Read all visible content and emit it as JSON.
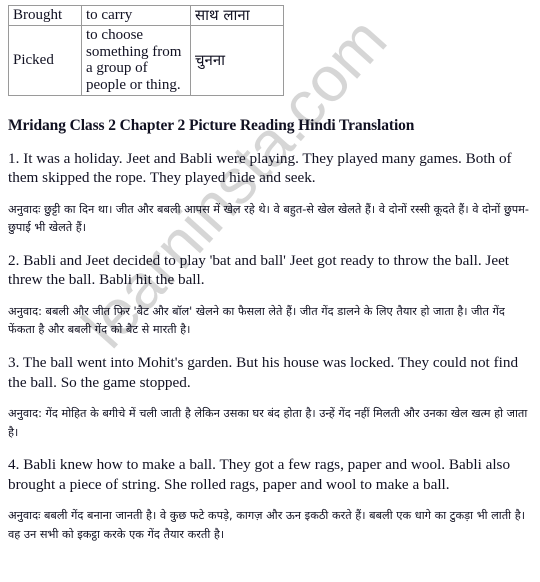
{
  "document": {
    "watermark_text": "learninsta.com",
    "watermark_color": "#cfcfcf",
    "text_color": "#111122",
    "table_border_color": "#9a9a9a"
  },
  "vocab_table": {
    "rows": [
      {
        "word": "Brought",
        "meaning": "to carry",
        "hindi": "साथ लाना"
      },
      {
        "word": "Picked",
        "meaning": "to choose something from a group of people or thing.",
        "hindi": "चुनना"
      }
    ]
  },
  "article": {
    "title": "Mridang Class 2 Chapter 2 Picture Reading Hindi Translation",
    "blocks": [
      {
        "english": "1. It was a holiday. Jeet and Babli were playing. They played many games. Both of them skipped the rope. They played hide and seek.",
        "hindi": "अनुवादः छुट्टी का दिन था। जीत और बबली आपस में खेल रहे थे। वे बहुत-से खेल खेलते हैं। वे दोनों रस्सी कूदते हैं। वे दोनों छुपम-छुपाई भी खेलते हैं।"
      },
      {
        "english": "2. Babli and Jeet decided to play 'bat and ball' Jeet got ready to throw the ball. Jeet threw the ball. Babli hit the ball.",
        "hindi": "अनुवाद: बबली और जीत फिर 'बैट और बॉल' खेलने का फैसला लेते हैं। जीत गेंद डालने के लिए तैयार हो जाता है। जीत गेंद फेंकता है और बबली गेंद को बैट से मारती है।"
      },
      {
        "english": "3. The ball went into Mohit's garden. But his house was locked. They could not find the ball. So the game stopped.",
        "hindi": "अनुवाद: गेंद मोहित के बगीचे में चली जाती है लेकिन उसका घर बंद होता है। उन्हें गेंद नहीं मिलती और उनका खेल खत्म हो जाता है।"
      },
      {
        "english": "4. Babli knew how to make a ball. They got a few rags, paper and wool. Babli also brought a piece of string. She rolled rags, paper and wool to make a ball.",
        "hindi": "अनुवादः बबली गेंद बनाना जानती है। वे कुछ फटे कपड़े, कागज़ और ऊन इकठी करते हैं। बबली एक धागे का टुकड़ा भी लाती है। वह उन सभी को इकट्ठा करके एक गेंद तैयार करती है।"
      }
    ]
  }
}
